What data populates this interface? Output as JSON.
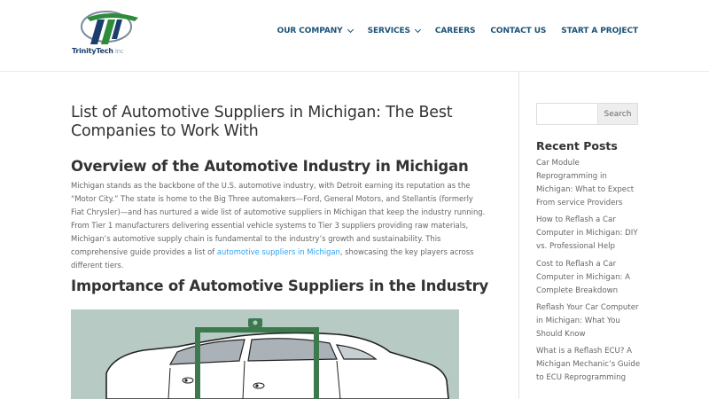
{
  "header": {
    "logo_text": "TrinityTech",
    "logo_suffix": "Inc",
    "nav": [
      {
        "label": "OUR COMPANY",
        "has_dropdown": true
      },
      {
        "label": "SERVICES",
        "has_dropdown": true
      },
      {
        "label": "CAREERS",
        "has_dropdown": false
      },
      {
        "label": "CONTACT US",
        "has_dropdown": false
      },
      {
        "label": "START A PROJECT",
        "has_dropdown": false
      }
    ]
  },
  "article": {
    "title": "List of Automotive Suppliers in Michigan: The Best Companies to Work With",
    "section1_heading": "Overview of the Automotive Industry in Michigan",
    "section1_text_before_link": "Michigan stands as the backbone of the U.S. automotive industry, with Detroit earning its reputation as the “Motor City.” The state is home to the Big Three automakers—Ford, General Motors, and Stellantis (formerly Fiat Chrysler)—and has nurtured a wide list of automotive suppliers in Michigan that keep the industry running. From Tier 1 manufacturers delivering essential vehicle systems to Tier 3 suppliers providing raw materials, Michigan’s automotive supply chain is fundamental to the industry’s growth and sustainability. This comprehensive guide provides a list of ",
    "section1_link": "automotive suppliers in Michigan",
    "section1_text_after_link": ", showcasing the key players across different tiers.",
    "section2_heading": "Importance of Automotive Suppliers in the Industry"
  },
  "sidebar": {
    "search_placeholder": "",
    "search_button": "Search",
    "recent_title": "Recent Posts",
    "recent_posts": [
      "Car Module Reprogramming in Michigan: What to Expect From service Providers",
      "How to Reflash a Car Computer in Michigan: DIY vs. Professional Help",
      "Cost to Reflash a Car Computer in Michigan: A Complete Breakdown",
      "Reflash Your Car Computer in Michigan: What You Should Know",
      "What is a Reflash ECU? A Michigan Mechanic’s Guide to ECU Reprogramming"
    ]
  },
  "colors": {
    "nav_text": "#1a5276",
    "link": "#2ea3f2",
    "illustration_bg": "#b7cac4",
    "lift_green": "#3c7a4e",
    "logo_green": "#2e8b3a",
    "logo_blue": "#1b3e6e"
  }
}
